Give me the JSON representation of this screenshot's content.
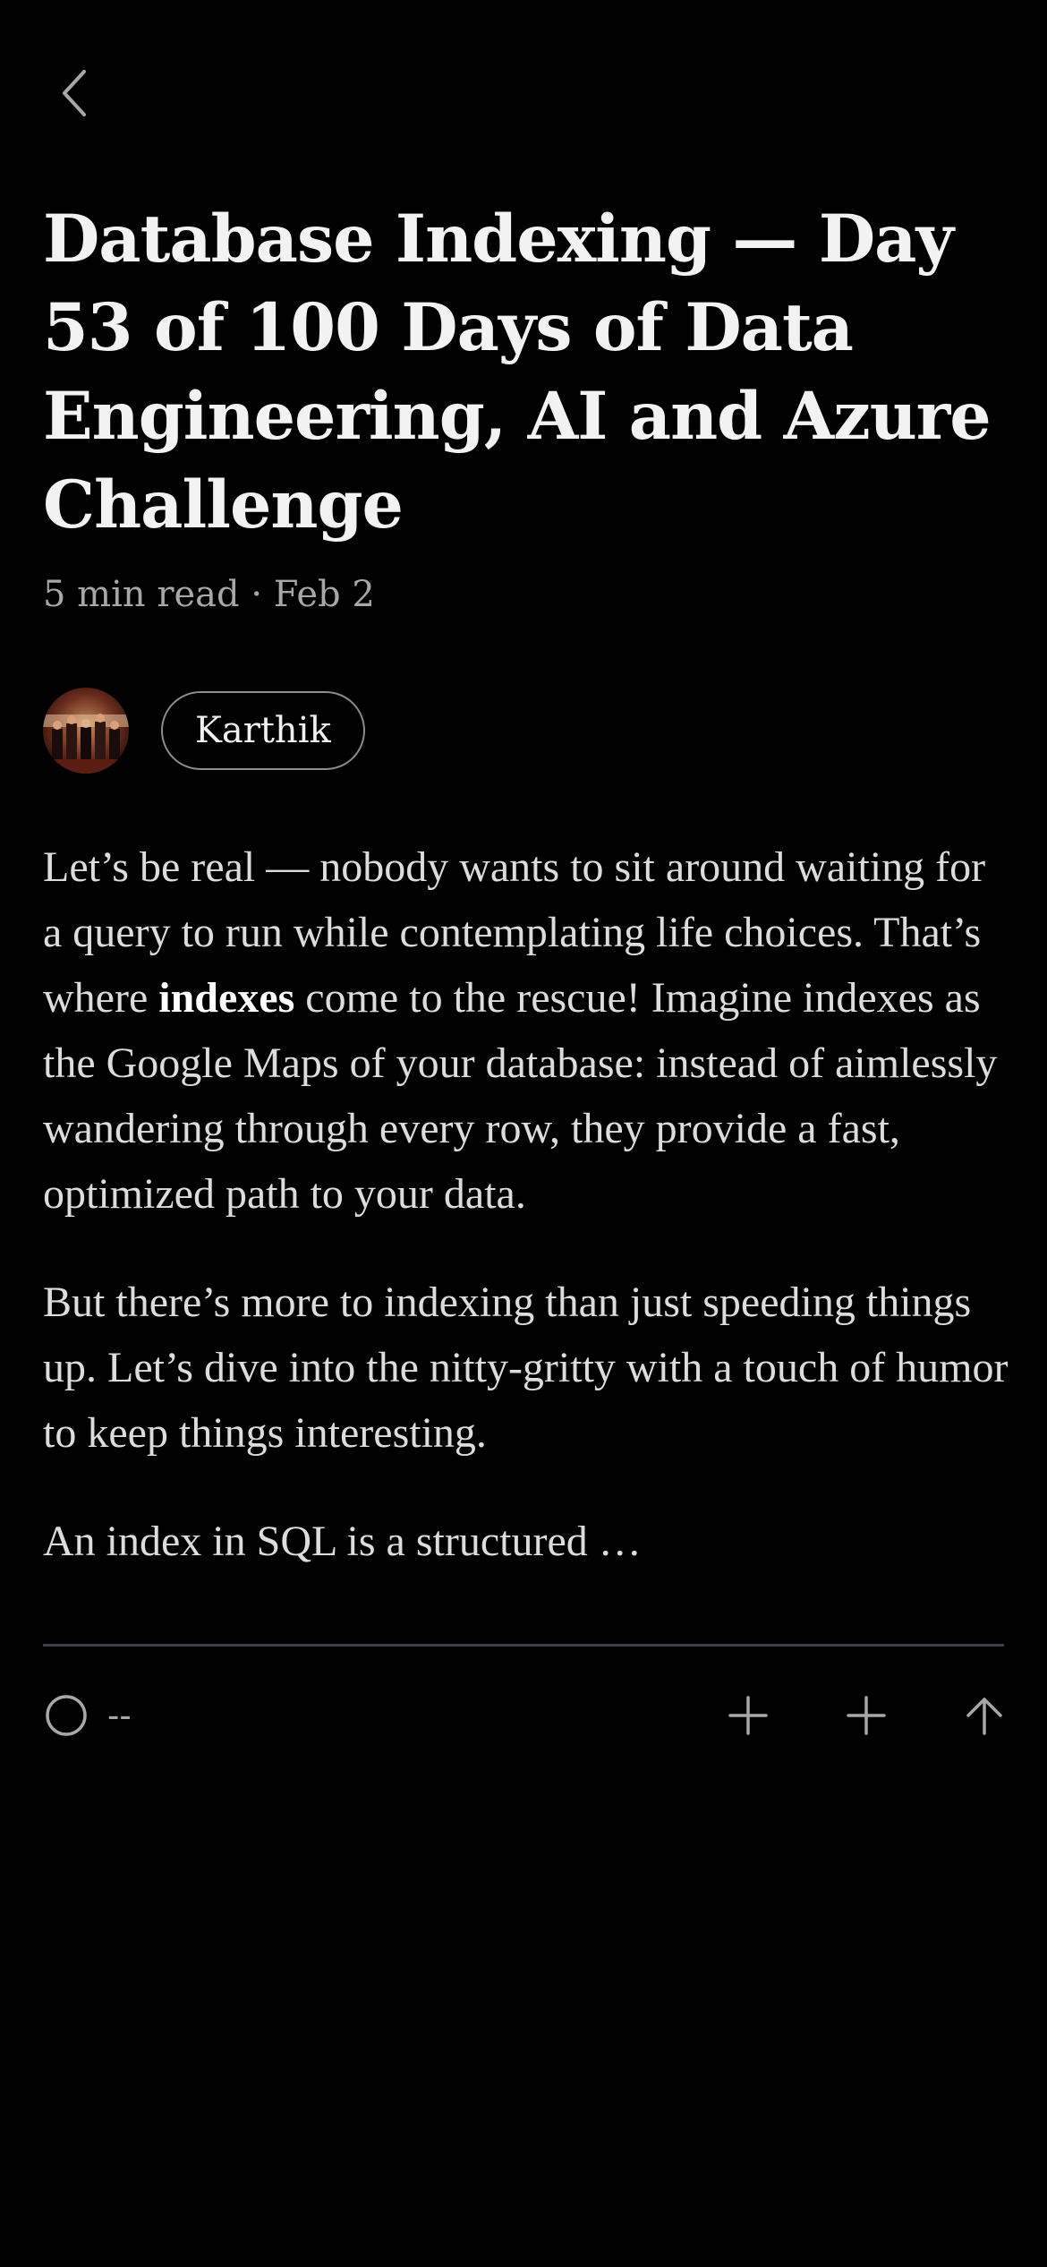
{
  "article": {
    "title": "Database Indexing — Day 53 of 100 Days of Data Engineering, AI and Azure Challenge",
    "read_time": "5 min read",
    "separator": " · ",
    "date": "Feb 2"
  },
  "author": {
    "name": "Karthik"
  },
  "body": {
    "p1_before": "Let’s be real — nobody wants to sit around waiting for a query to run while contemplating life choices. That’s where ",
    "p1_bold": "indexes",
    "p1_after": " come to the rescue! Imagine indexes as the Google Maps of your database: instead of aimlessly wandering through every row, they provide a fast, optimized path to your data.",
    "p2": "But there’s more to indexing than just speeding things up. Let’s dive into the nitty-gritty with a touch of humor to keep things interesting.",
    "p3": "An index in SQL is a structured …"
  },
  "actions": {
    "clap_count": "--",
    "icons": [
      "back-icon",
      "clap-icon",
      "plus-icon",
      "plus-icon",
      "share-arrow-up-icon"
    ]
  },
  "colors": {
    "background": "#000000",
    "text": "#dcdcdc",
    "muted": "#a7a7a7",
    "divider": "#3a3f4a"
  }
}
